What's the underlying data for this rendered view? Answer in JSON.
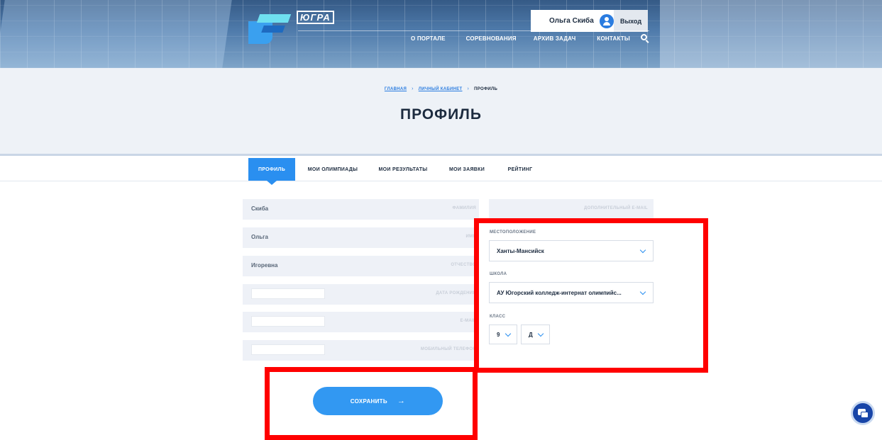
{
  "header": {
    "logo_text": "ЮГРА",
    "user_name": "Ольга Скиба",
    "logout_label": "Выход",
    "nav": [
      "О ПОРТАЛЕ",
      "СОРЕВНОВАНИЯ",
      "АРХИВ ЗАДАЧ",
      "КОНТАКТЫ"
    ]
  },
  "breadcrumb": {
    "home": "ГЛАВНАЯ",
    "cabinet": "ЛИЧНЫЙ КАБИНЕТ",
    "current": "ПРОФИЛЬ",
    "separator": "›"
  },
  "page_title": "ПРОФИЛЬ",
  "tabs": [
    {
      "label": "ПРОФИЛЬ",
      "active": true
    },
    {
      "label": "МОИ ОЛИМПИАДЫ",
      "active": false
    },
    {
      "label": "МОИ РЕЗУЛЬТАТЫ",
      "active": false
    },
    {
      "label": "МОИ ЗАЯВКИ",
      "active": false
    },
    {
      "label": "РЕЙТИНГ",
      "active": false
    }
  ],
  "form": {
    "surname": {
      "value": "Скиба",
      "label": "ФАМИЛИЯ"
    },
    "name": {
      "value": "Ольга",
      "label": "ИМЯ"
    },
    "patronymic": {
      "value": "Игоревна",
      "label": "ОТЧЕСТВО"
    },
    "birthdate": {
      "value": "",
      "label": "ДАТА РОЖДЕНИЯ"
    },
    "email": {
      "value": "",
      "label": "E-MAIL"
    },
    "phone": {
      "value": "",
      "label": "МОБИЛЬНЫЙ ТЕЛЕФОН"
    },
    "extra_email": {
      "value": "",
      "label": "ДОПОЛНИТЕЛЬНЫЙ E-MAIL"
    },
    "location": {
      "label": "МЕСТОПОЛОЖЕНИЕ",
      "value": "Ханты-Мансийск"
    },
    "school": {
      "label": "ШКОЛА",
      "value": "АУ Югорский колледж-интернат олимпийс..."
    },
    "class": {
      "label": "КЛАСС",
      "grade": "9",
      "letter": "Д"
    },
    "save_label": "СОХРАНИТЬ",
    "save_arrow": "→"
  },
  "colors": {
    "accent": "#2a8ff0",
    "title": "#1c2b3f",
    "annotation": "#ff0000"
  }
}
